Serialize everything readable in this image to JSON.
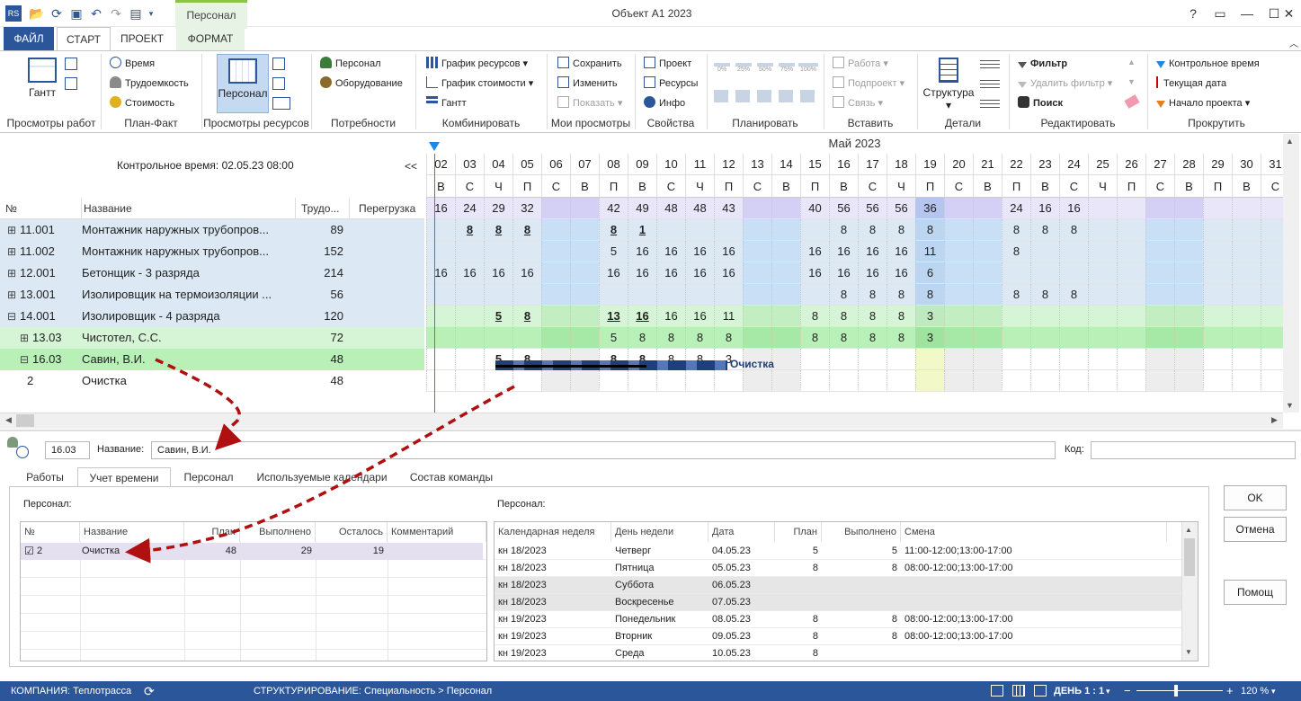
{
  "window": {
    "title": "Объект А1 2023",
    "context_tab": "Персонал",
    "icon_label": "RS"
  },
  "ribbon_tabs": [
    "ФАЙЛ",
    "СТАРТ",
    "ПРОЕКТ",
    "ФОРМАТ"
  ],
  "ribbon": {
    "groups": [
      "Просмотры работ",
      "План-Факт",
      "Просмотры ресурсов",
      "Потребности",
      "Комбинировать",
      "Мои просмотры",
      "Свойства",
      "Планировать",
      "Вставить",
      "Детали",
      "Редактировать",
      "Прокрутить"
    ],
    "gantt_btn": "Гантт",
    "plan_fact": [
      "Время",
      "Трудоемкость",
      "Стоимость"
    ],
    "resource_btn": "Персонал",
    "needs": [
      "Персонал",
      "Оборудование"
    ],
    "combine": [
      "График ресурсов",
      "График стоимости",
      "Гантт"
    ],
    "my_views": [
      "Сохранить",
      "Изменить",
      "Показать"
    ],
    "props": [
      "Проект",
      "Ресурсы",
      "Инфо"
    ],
    "plan_pcts": [
      "0%",
      "25%",
      "50%",
      "75%",
      "100%"
    ],
    "insert": [
      "Работа",
      "Подпроект",
      "Связь"
    ],
    "details_btn": "Структура",
    "edit": [
      "Фильтр",
      "Удалить фильтр",
      "Поиск"
    ],
    "scroll": [
      "Контрольное время",
      "Текущая дата",
      "Начало проекта"
    ]
  },
  "control_time": "Контрольное время: 02.05.23 08:00",
  "collapse": "<<",
  "table": {
    "headers": [
      "№",
      "Название",
      "Трудо...",
      "Перегрузка"
    ],
    "rows": [
      {
        "num": "11.001",
        "name": "Монтажник наружных трубопров...",
        "val": "89",
        "exp": "⊞"
      },
      {
        "num": "11.002",
        "name": "Монтажник наружных трубопров...",
        "val": "152",
        "exp": "⊞"
      },
      {
        "num": "12.001",
        "name": "Бетонщик - 3 разряда",
        "val": "214",
        "exp": "⊞"
      },
      {
        "num": "13.001",
        "name": "Изолировщик на термоизоляции ...",
        "val": "56",
        "exp": "⊞"
      },
      {
        "num": "14.001",
        "name": "Изолировщик - 4 разряда",
        "val": "120",
        "exp": "⊟"
      },
      {
        "num": "13.03",
        "name": "Чистотел, С.С.",
        "val": "72",
        "exp": "⊞"
      },
      {
        "num": "16.03",
        "name": "Савин, В.И.",
        "val": "48",
        "exp": "⊟"
      },
      {
        "num": "2",
        "name": "Очистка",
        "val": "48",
        "exp": ""
      }
    ]
  },
  "gantt": {
    "month": "Май 2023",
    "days": [
      "02",
      "03",
      "04",
      "05",
      "06",
      "07",
      "08",
      "09",
      "10",
      "11",
      "12",
      "13",
      "14",
      "15",
      "16",
      "17",
      "18",
      "19",
      "20",
      "21",
      "22",
      "23",
      "24",
      "25",
      "26",
      "27",
      "28",
      "29",
      "30",
      "31"
    ],
    "weekdays": [
      "В",
      "С",
      "Ч",
      "П",
      "С",
      "В",
      "П",
      "В",
      "С",
      "Ч",
      "П",
      "С",
      "В",
      "П",
      "В",
      "С",
      "Ч",
      "П",
      "С",
      "В",
      "П",
      "В",
      "С",
      "Ч",
      "П",
      "С",
      "В",
      "П",
      "В",
      "С"
    ],
    "rows": [
      [
        "16",
        "24",
        "29",
        "32",
        "",
        "",
        "42",
        "49",
        "48",
        "48",
        "43",
        "",
        "",
        "40",
        "56",
        "56",
        "56",
        "36",
        "",
        "",
        "24",
        "16",
        "16",
        "",
        "",
        "",
        "",
        "",
        "",
        ""
      ],
      [
        "",
        "8",
        "8",
        "8",
        "",
        "",
        "8",
        "1",
        "",
        "",
        "",
        "",
        "",
        "",
        "8",
        "8",
        "8",
        "8",
        "",
        "",
        "8",
        "8",
        "8",
        "",
        "",
        "",
        "",
        "",
        "",
        ""
      ],
      [
        "",
        "",
        "",
        "",
        "",
        "",
        "5",
        "16",
        "16",
        "16",
        "16",
        "",
        "",
        "16",
        "16",
        "16",
        "16",
        "11",
        "",
        "",
        "8",
        "",
        "",
        "",
        "",
        "",
        "",
        "",
        "",
        ""
      ],
      [
        "16",
        "16",
        "16",
        "16",
        "",
        "",
        "16",
        "16",
        "16",
        "16",
        "16",
        "",
        "",
        "16",
        "16",
        "16",
        "16",
        "6",
        "",
        "",
        "",
        "",
        "",
        "",
        "",
        "",
        "",
        "",
        "",
        ""
      ],
      [
        "",
        "",
        "",
        "",
        "",
        "",
        "",
        "",
        "",
        "",
        "",
        "",
        "",
        "",
        "8",
        "8",
        "8",
        "8",
        "",
        "",
        "8",
        "8",
        "8",
        "",
        "",
        "",
        "",
        "",
        "",
        ""
      ],
      [
        "",
        "",
        "5",
        "8",
        "",
        "",
        "13",
        "16",
        "16",
        "16",
        "11",
        "",
        "",
        "8",
        "8",
        "8",
        "8",
        "3",
        "",
        "",
        "",
        "",
        "",
        "",
        "",
        "",
        "",
        "",
        "",
        ""
      ],
      [
        "",
        "",
        "",
        "",
        "",
        "",
        "5",
        "8",
        "8",
        "8",
        "8",
        "",
        "",
        "8",
        "8",
        "8",
        "8",
        "3",
        "",
        "",
        "",
        "",
        "",
        "",
        "",
        "",
        "",
        "",
        "",
        ""
      ],
      [
        "",
        "",
        "5",
        "8",
        "",
        "",
        "8",
        "8",
        "8",
        "8",
        "3",
        "",
        "",
        "",
        "",
        "",
        "",
        "",
        "",
        "",
        "",
        "",
        "",
        "",
        "",
        "",
        "",
        "",
        "",
        ""
      ]
    ],
    "task_label": "Очистка"
  },
  "detail": {
    "code": "16.03",
    "name_label": "Название:",
    "name_value": "Савин, В.И.",
    "code_label": "Код:",
    "tabs": [
      "Работы",
      "Учет времени",
      "Персонал",
      "Используемые календари",
      "Состав команды"
    ],
    "left_title": "Персонал:",
    "right_title": "Персонал:",
    "left_headers": [
      "№",
      "Название",
      "План",
      "Выполнено",
      "Осталось",
      "Комментарий"
    ],
    "left_row": {
      "num": "2",
      "name": "Очистка",
      "plan": "48",
      "done": "29",
      "left": "19"
    },
    "right_headers": [
      "Календарная неделя",
      "День недели",
      "Дата",
      "План",
      "Выполнено",
      "Смена"
    ],
    "right_rows": [
      {
        "week": "кн 18/2023",
        "day": "Четверг",
        "date": "04.05.23",
        "plan": "5",
        "done": "5",
        "shift": "11:00-12:00;13:00-17:00",
        "off": false
      },
      {
        "week": "кн 18/2023",
        "day": "Пятница",
        "date": "05.05.23",
        "plan": "8",
        "done": "8",
        "shift": "08:00-12:00;13:00-17:00",
        "off": false
      },
      {
        "week": "кн 18/2023",
        "day": "Суббота",
        "date": "06.05.23",
        "plan": "",
        "done": "",
        "shift": "",
        "off": true
      },
      {
        "week": "кн 18/2023",
        "day": "Воскресенье",
        "date": "07.05.23",
        "plan": "",
        "done": "",
        "shift": "",
        "off": true
      },
      {
        "week": "кн 19/2023",
        "day": "Понедельник",
        "date": "08.05.23",
        "plan": "8",
        "done": "8",
        "shift": "08:00-12:00;13:00-17:00",
        "off": false
      },
      {
        "week": "кн 19/2023",
        "day": "Вторник",
        "date": "09.05.23",
        "plan": "8",
        "done": "8",
        "shift": "08:00-12:00;13:00-17:00",
        "off": false
      },
      {
        "week": "кн 19/2023",
        "day": "Среда",
        "date": "10.05.23",
        "plan": "8",
        "done": "",
        "shift": "",
        "off": false
      }
    ],
    "buttons": [
      "OK",
      "Отмена",
      "Помощ"
    ]
  },
  "status": {
    "company": "КОМПАНИЯ: Теплотрасса",
    "struct": "СТРУКТУРИРОВАНИЕ: Специальность > Персонал",
    "day": "ДЕНЬ 1 : 1",
    "zoom": "120 %"
  },
  "colors": {
    "accent": "#2b579a",
    "ctx_green": "#8bc34a",
    "arrow": "#b01010"
  }
}
